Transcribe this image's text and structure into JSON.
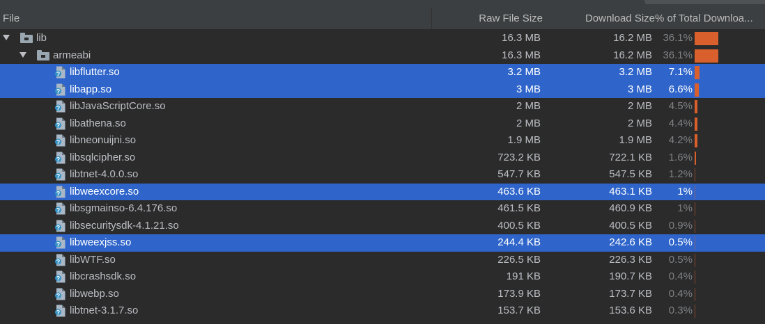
{
  "header": {
    "file": "File",
    "raw_size": "Raw File Size",
    "download_size": "Download Size",
    "percent": "% of Total Downloa..."
  },
  "rows": [
    {
      "name": "lib",
      "raw": "16.3 MB",
      "dl": "16.2 MB",
      "pct": "36.1%",
      "percent_value": 36.1,
      "level": 0,
      "kind": "folder",
      "expanded": true,
      "selected": false
    },
    {
      "name": "armeabi",
      "raw": "16.3 MB",
      "dl": "16.2 MB",
      "pct": "36.1%",
      "percent_value": 36.1,
      "level": 1,
      "kind": "folder",
      "expanded": true,
      "selected": false
    },
    {
      "name": "libflutter.so",
      "raw": "3.2 MB",
      "dl": "3.2 MB",
      "pct": "7.1%",
      "percent_value": 7.1,
      "level": 2,
      "kind": "file",
      "selected": true
    },
    {
      "name": "libapp.so",
      "raw": "3 MB",
      "dl": "3 MB",
      "pct": "6.6%",
      "percent_value": 6.6,
      "level": 2,
      "kind": "file",
      "selected": true
    },
    {
      "name": "libJavaScriptCore.so",
      "raw": "2 MB",
      "dl": "2 MB",
      "pct": "4.5%",
      "percent_value": 4.5,
      "level": 2,
      "kind": "file",
      "selected": false
    },
    {
      "name": "libathena.so",
      "raw": "2 MB",
      "dl": "2 MB",
      "pct": "4.4%",
      "percent_value": 4.4,
      "level": 2,
      "kind": "file",
      "selected": false
    },
    {
      "name": "libneonuijni.so",
      "raw": "1.9 MB",
      "dl": "1.9 MB",
      "pct": "4.2%",
      "percent_value": 4.2,
      "level": 2,
      "kind": "file",
      "selected": false
    },
    {
      "name": "libsqlcipher.so",
      "raw": "723.2 KB",
      "dl": "722.1 KB",
      "pct": "1.6%",
      "percent_value": 1.6,
      "level": 2,
      "kind": "file",
      "selected": false
    },
    {
      "name": "libtnet-4.0.0.so",
      "raw": "547.7 KB",
      "dl": "547.5 KB",
      "pct": "1.2%",
      "percent_value": 1.2,
      "level": 2,
      "kind": "file",
      "selected": false
    },
    {
      "name": "libweexcore.so",
      "raw": "463.6 KB",
      "dl": "463.1 KB",
      "pct": "1%",
      "percent_value": 1.0,
      "level": 2,
      "kind": "file",
      "selected": true
    },
    {
      "name": "libsgmainso-6.4.176.so",
      "raw": "461.5 KB",
      "dl": "460.9 KB",
      "pct": "1%",
      "percent_value": 1.0,
      "level": 2,
      "kind": "file",
      "selected": false
    },
    {
      "name": "libsecuritysdk-4.1.21.so",
      "raw": "400.5 KB",
      "dl": "400.5 KB",
      "pct": "0.9%",
      "percent_value": 0.9,
      "level": 2,
      "kind": "file",
      "selected": false
    },
    {
      "name": "libweexjss.so",
      "raw": "244.4 KB",
      "dl": "242.6 KB",
      "pct": "0.5%",
      "percent_value": 0.5,
      "level": 2,
      "kind": "file",
      "selected": true
    },
    {
      "name": "libWTF.so",
      "raw": "226.5 KB",
      "dl": "226.3 KB",
      "pct": "0.5%",
      "percent_value": 0.5,
      "level": 2,
      "kind": "file",
      "selected": false
    },
    {
      "name": "libcrashsdk.so",
      "raw": "191 KB",
      "dl": "190.7 KB",
      "pct": "0.4%",
      "percent_value": 0.4,
      "level": 2,
      "kind": "file",
      "selected": false
    },
    {
      "name": "libwebp.so",
      "raw": "173.9 KB",
      "dl": "173.7 KB",
      "pct": "0.4%",
      "percent_value": 0.4,
      "level": 2,
      "kind": "file",
      "selected": false
    },
    {
      "name": "libtnet-3.1.7.so",
      "raw": "153.7 KB",
      "dl": "153.6 KB",
      "pct": "0.3%",
      "percent_value": 0.3,
      "level": 2,
      "kind": "file",
      "selected": false
    }
  ],
  "colors": {
    "background": "#2b2b2b",
    "header": "#3c3f41",
    "selection": "#2f65ca",
    "bar": "#d95f2c"
  },
  "icons": {
    "expand": "chevron-down-icon",
    "folder": "folder-icon",
    "file": "unknown-file-icon"
  }
}
